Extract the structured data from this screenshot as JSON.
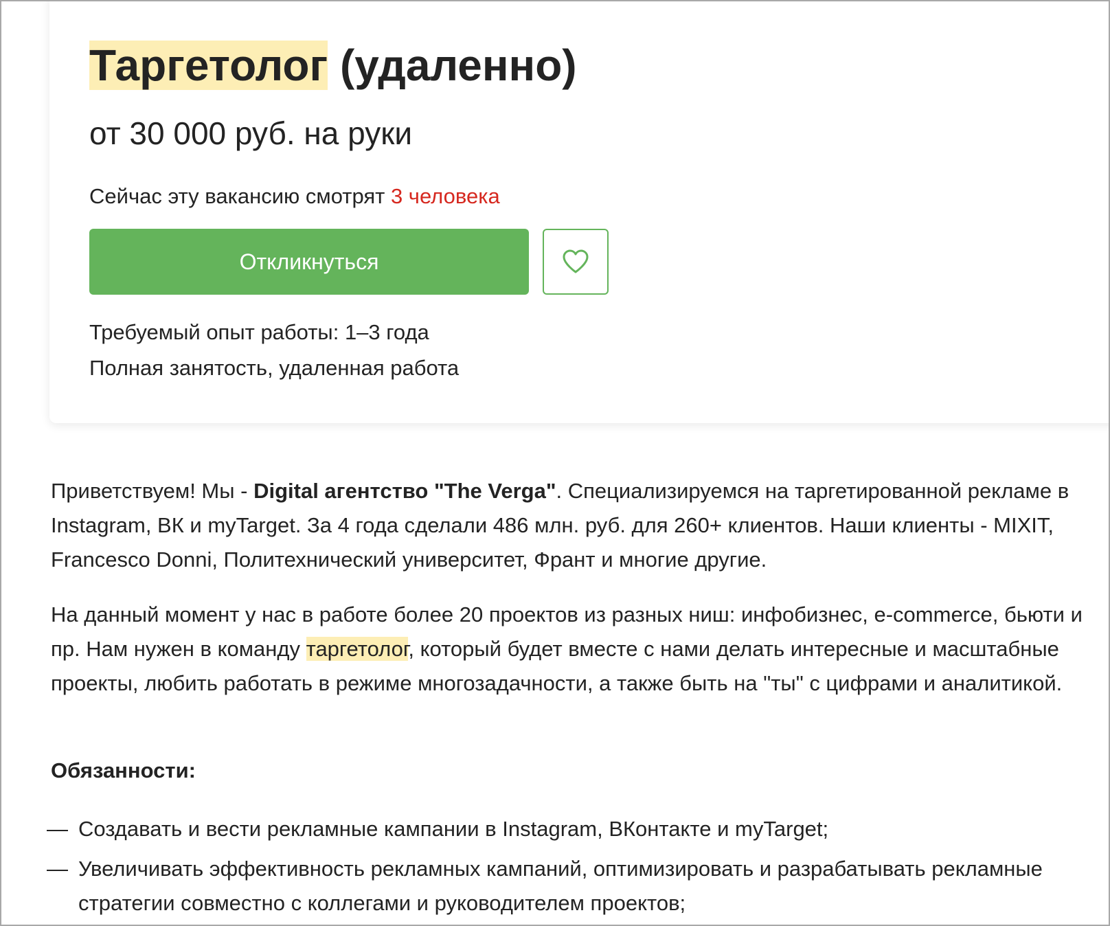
{
  "vacancy": {
    "title_keyword": "Таргетолог",
    "title_rest": " (удаленно)",
    "salary": "от 30 000 руб. на руки",
    "viewers_prefix": "Сейчас эту вакансию смотрят ",
    "viewers_count": "3 человека",
    "respond_label": "Откликнуться",
    "favorite_icon": "heart-icon",
    "experience": "Требуемый опыт работы: 1–3 года",
    "employment": "Полная занятость, удаленная работа"
  },
  "description": {
    "p1_start": "Приветствуем! Мы - ",
    "p1_bold": "Digital агентство \"The Verga\"",
    "p1_end": ". Специализируемся на таргетированной рекламе в Instagram, ВК и myTarget. За 4 года сделали 486 млн. руб. для 260+ клиентов. Наши клиенты - MIXIT, Francesco Donni, Политехнический университет, Франт и многие другие.",
    "p2_start": "На данный момент у нас в работе более 20 проектов из разных ниш: инфобизнес, e-commerce, бьюти и пр. Нам нужен в команду ",
    "p2_highlight": "таргетолог",
    "p2_end": ", который будет вместе с нами делать интересные и масштабные проекты, любить работать в режиме многозадачности, а также быть на \"ты\" с цифрами и аналитикой.",
    "duties_title": "Обязанности:",
    "duties": [
      {
        "dash": "—",
        "text": "Создавать и вести рекламные кампании в Instagram, ВКонтакте и myTarget;"
      },
      {
        "dash": "—",
        "text": "Увеличивать эффективность рекламных кампаний, оптимизировать и разрабатывать рекламные стратегии совместно с коллегами и руководителем проектов;"
      }
    ]
  },
  "colors": {
    "accent_green": "#64b45b",
    "highlight": "#fdeeb5",
    "alert_red": "#d6281f"
  }
}
